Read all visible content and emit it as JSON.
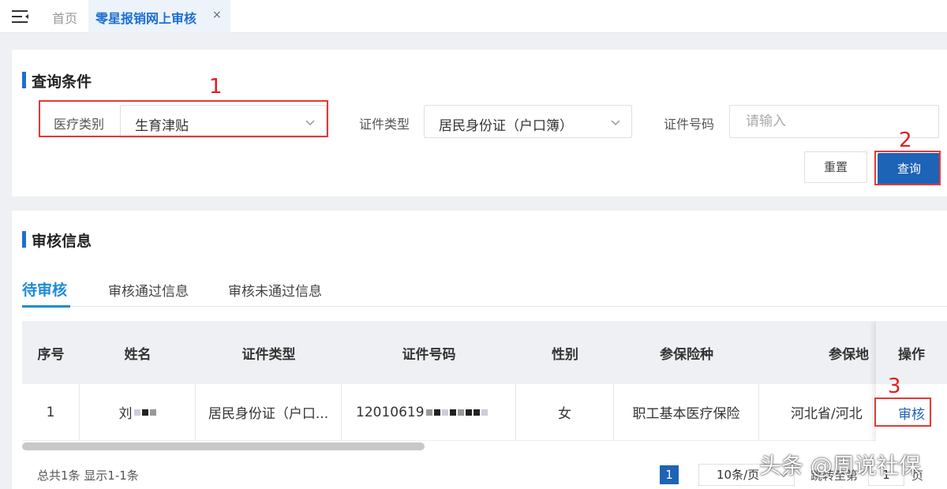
{
  "topbar": {
    "menu_icon": "menu-collapse-icon",
    "tab_home": "首页",
    "tab_active": "零星报销网上审核",
    "tab_close": "×"
  },
  "query": {
    "title": "查询条件",
    "medical_type_label": "医疗类别",
    "medical_type_value": "生育津贴",
    "id_type_label": "证件类型",
    "id_type_value": "居民身份证（户口簿）",
    "id_number_label": "证件号码",
    "id_number_placeholder": "请输入",
    "reset_label": "重置",
    "query_label": "查询"
  },
  "annotations": {
    "step1": "1",
    "step2": "2",
    "step3": "3"
  },
  "audit": {
    "title": "审核信息",
    "tabs": [
      {
        "label": "待审核"
      },
      {
        "label": "审核通过信息"
      },
      {
        "label": "审核未通过信息"
      }
    ],
    "columns": [
      "序号",
      "姓名",
      "证件类型",
      "证件号码",
      "性别",
      "参保险种",
      "参保地",
      "操作"
    ],
    "rows": [
      {
        "index": "1",
        "name": "刘",
        "id_type": "居民身份证（户口...",
        "id_number": "12010619",
        "gender": "女",
        "insurance": "职工基本医疗保险",
        "location": "河北省/河北",
        "action": "审核"
      }
    ]
  },
  "pager": {
    "summary": "总共1条 显示1-1条",
    "current_page": "1",
    "page_size": "10条/页",
    "jump_label": "跳转至第",
    "jump_value": "1",
    "jump_unit": "页"
  },
  "watermark": "头条 @周说社保",
  "colors": {
    "primary": "#1d63b6",
    "tab_active": "#1d8bd8",
    "annotation": "#e53935"
  }
}
